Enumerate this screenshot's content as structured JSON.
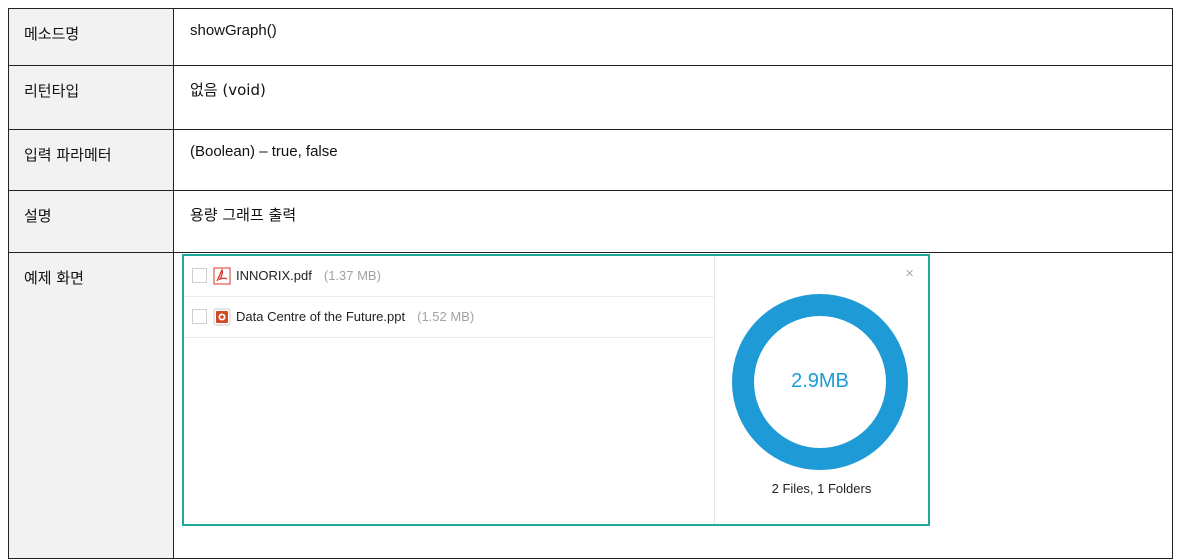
{
  "rows": [
    {
      "label": "메소드명",
      "value": "showGraph()"
    },
    {
      "label": "리턴타입",
      "value": "없음 (void)"
    },
    {
      "label": "입력 파라메터",
      "value": "(Boolean) – true, false"
    },
    {
      "label": "설명",
      "value": "용량 그래프 출력"
    },
    {
      "label": "예제 화면"
    }
  ],
  "uploader": {
    "files": [
      {
        "name": "INNORIX.pdf",
        "size": "(1.37 MB)",
        "icon": "pdf-icon"
      },
      {
        "name": "Data Centre of the Future.ppt",
        "size": "(1.52 MB)",
        "icon": "ppt-icon"
      }
    ],
    "close_label": "×",
    "total_size": "2.9MB",
    "summary": "2 Files, 1 Folders",
    "progress": 1.0,
    "colors": {
      "accent": "#1e9bd6",
      "border": "#20a89a",
      "pdf": "#d9342b",
      "ppt": "#d04a24"
    }
  }
}
